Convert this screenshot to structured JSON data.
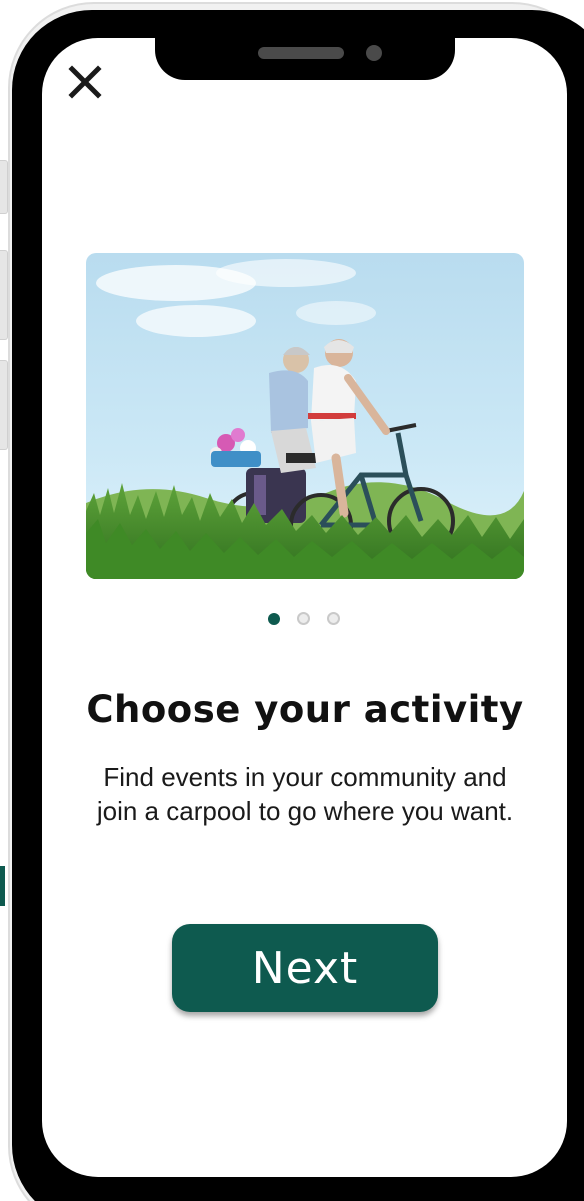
{
  "onboarding": {
    "close_icon": "close-icon",
    "hero_image": "senior-couple-cycling-photo",
    "pager": {
      "total": 3,
      "active_index": 0
    },
    "title": "Choose your activity",
    "description": "Find events in your community and join a carpool to go where you want.",
    "next_label": "Next"
  },
  "colors": {
    "accent": "#0e5a4f",
    "frame": "#000000",
    "dot_inactive": "#ededed"
  }
}
